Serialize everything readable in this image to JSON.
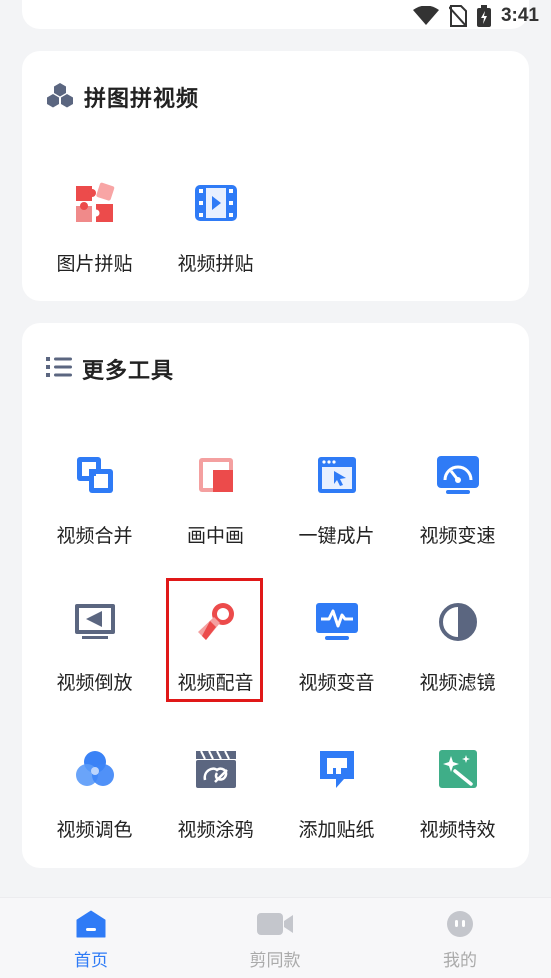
{
  "status_bar": {
    "time": "3:41"
  },
  "collage_section": {
    "title": "拼图拼视频",
    "items": [
      {
        "label": "图片拼贴",
        "icon": "puzzle-icon"
      },
      {
        "label": "视频拼贴",
        "icon": "film-icon"
      }
    ]
  },
  "tools_section": {
    "title": "更多工具",
    "items": [
      {
        "label": "视频合并",
        "icon": "merge-icon"
      },
      {
        "label": "画中画",
        "icon": "picture-in-picture-icon"
      },
      {
        "label": "一键成片",
        "icon": "one-click-window-icon"
      },
      {
        "label": "视频变速",
        "icon": "speedometer-icon"
      },
      {
        "label": "视频倒放",
        "icon": "reverse-play-icon"
      },
      {
        "label": "视频配音",
        "icon": "microphone-icon"
      },
      {
        "label": "视频变音",
        "icon": "voice-wave-monitor-icon"
      },
      {
        "label": "视频滤镜",
        "icon": "half-circle-filter-icon"
      },
      {
        "label": "视频调色",
        "icon": "color-circles-icon"
      },
      {
        "label": "视频涂鸦",
        "icon": "clapper-doodle-icon"
      },
      {
        "label": "添加贴纸",
        "icon": "sticker-icon"
      },
      {
        "label": "视频特效",
        "icon": "sparkle-effects-icon"
      }
    ]
  },
  "tab_bar": {
    "tabs": [
      {
        "label": "首页",
        "icon": "home-icon",
        "active": true
      },
      {
        "label": "剪同款",
        "icon": "video-camera-icon",
        "active": false
      },
      {
        "label": "我的",
        "icon": "profile-face-icon",
        "active": false
      }
    ]
  },
  "colors": {
    "accent": "#2f7bf6",
    "highlight_border": "#e01818",
    "red_icon": "#ec4b4b",
    "slate_icon": "#5b6680",
    "green_icon": "#3fae88",
    "background": "#f3f4f6"
  }
}
